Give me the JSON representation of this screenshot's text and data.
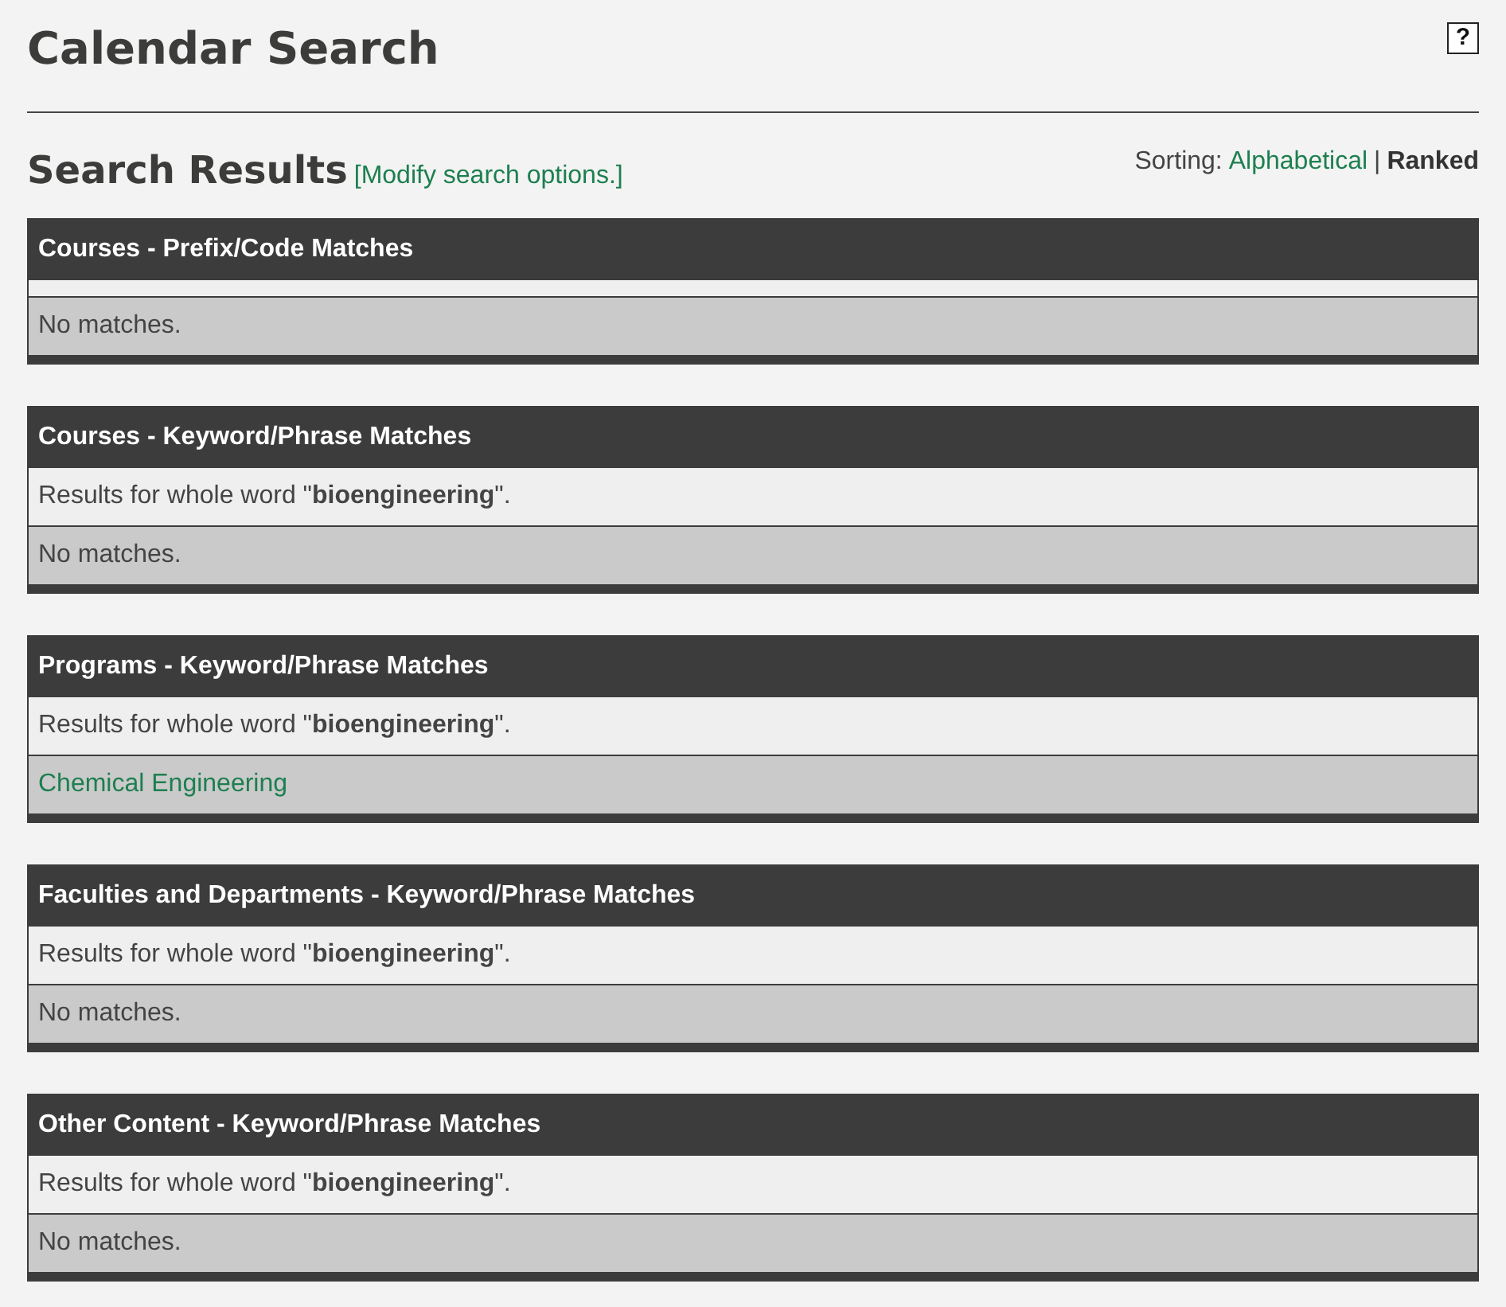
{
  "page": {
    "title": "Calendar Search",
    "help_button": "?"
  },
  "results_heading": {
    "title": "Search Results",
    "modify_link": "[Modify search options.]"
  },
  "sorting": {
    "label": "Sorting:",
    "separator": "|",
    "options": [
      {
        "label": "Alphabetical",
        "selected": false
      },
      {
        "label": "Ranked",
        "selected": true
      }
    ]
  },
  "sections": [
    {
      "title": "Courses - Prefix/Code Matches",
      "results": [
        {
          "kind": "text",
          "text": "No matches."
        }
      ]
    },
    {
      "title": "Courses - Keyword/Phrase Matches",
      "note": "Results for whole word \"**bioengineering**\".",
      "results": [
        {
          "kind": "text",
          "text": "No matches."
        }
      ]
    },
    {
      "title": "Programs - Keyword/Phrase Matches",
      "note": "Results for whole word \"**bioengineering**\".",
      "results": [
        {
          "kind": "link",
          "text": "Chemical Engineering"
        }
      ]
    },
    {
      "title": "Faculties and Departments - Keyword/Phrase Matches",
      "note": "Results for whole word \"**bioengineering**\".",
      "results": [
        {
          "kind": "text",
          "text": "No matches."
        }
      ]
    },
    {
      "title": "Other Content - Keyword/Phrase Matches",
      "note": "Results for whole word \"**bioengineering**\".",
      "results": [
        {
          "kind": "text",
          "text": "No matches."
        }
      ]
    }
  ]
}
